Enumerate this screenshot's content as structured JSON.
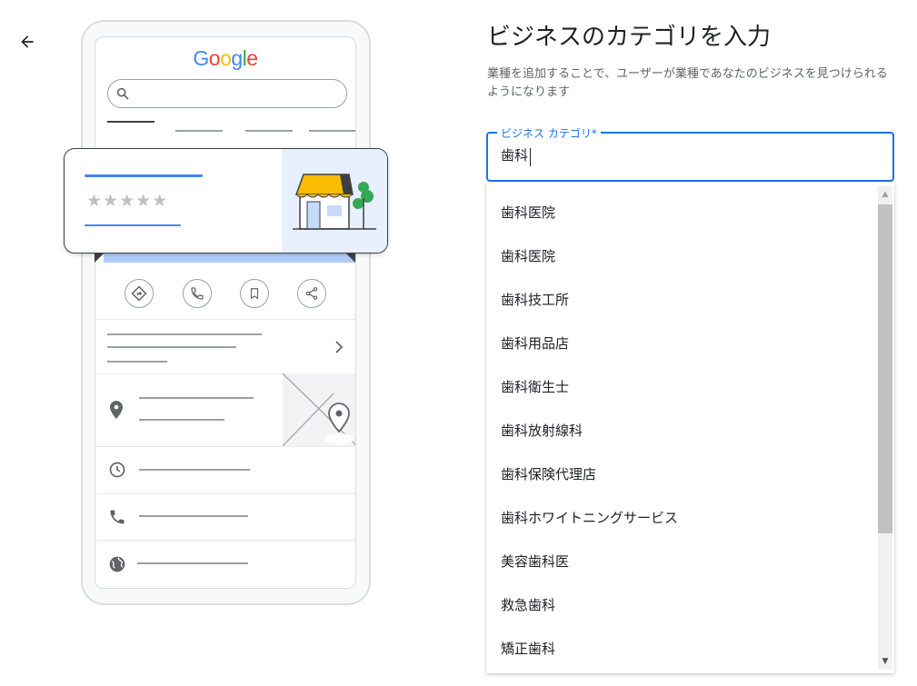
{
  "header": {
    "title": "ビジネスのカテゴリを入力",
    "description": "業種を追加することで、ユーザーが業種であなたのビジネスを見つけられるようになります"
  },
  "illustration": {
    "logo_letters": [
      "G",
      "o",
      "o",
      "g",
      "l",
      "e"
    ],
    "logo_colors": [
      "#4285F4",
      "#EA4335",
      "#FBBC05",
      "#4285F4",
      "#34A853",
      "#EA4335"
    ],
    "rating_stars": "★★★★★"
  },
  "field": {
    "label": "ビジネス カテゴリ*",
    "value": "歯科"
  },
  "dropdown": {
    "options": [
      "歯科医院",
      "歯科医院",
      "歯科技工所",
      "歯科用品店",
      "歯科衛生士",
      "歯科放射線科",
      "歯科保険代理店",
      "歯科ホワイトニングサービス",
      "美容歯科医",
      "救急歯科",
      "矯正歯科"
    ],
    "scroll_up": "▲",
    "scroll_down": "▼"
  },
  "icons": [
    "arrow-left-icon",
    "search-icon",
    "directions-icon",
    "phone-icon",
    "bookmark-icon",
    "share-icon",
    "chevron-right-icon",
    "location-pin-icon",
    "clock-icon",
    "globe-icon",
    "store-icon",
    "map-pin-icon"
  ],
  "colors": {
    "accent": "#1a73e8",
    "illustration_blue": "#4285f4",
    "awning": "#fbbc04"
  }
}
